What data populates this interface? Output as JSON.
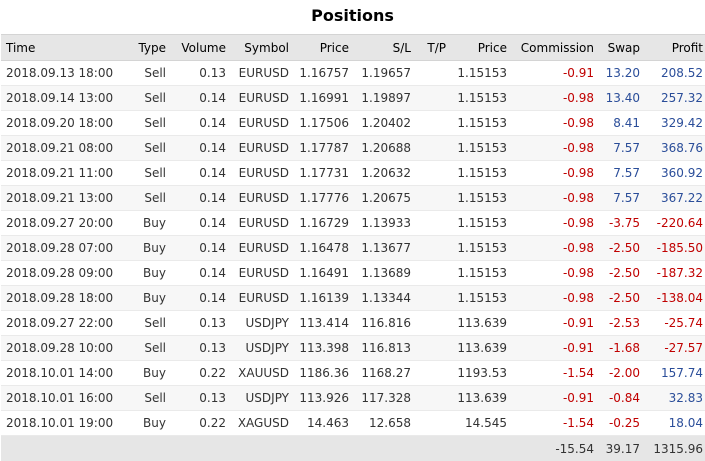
{
  "title": "Positions",
  "columns": {
    "time": "Time",
    "type": "Type",
    "volume": "Volume",
    "symbol": "Symbol",
    "price": "Price",
    "sl": "S/L",
    "tp": "T/P",
    "price2": "Price",
    "commission": "Commission",
    "swap": "Swap",
    "profit": "Profit"
  },
  "rows": [
    {
      "time": "2018.09.13 18:00",
      "type": "Sell",
      "volume": "0.13",
      "symbol": "EURUSD",
      "price": "1.16757",
      "sl": "1.19657",
      "tp": "",
      "price2": "1.15153",
      "commission": "-0.91",
      "swap": "13.20",
      "profit": "208.52"
    },
    {
      "time": "2018.09.14 13:00",
      "type": "Sell",
      "volume": "0.14",
      "symbol": "EURUSD",
      "price": "1.16991",
      "sl": "1.19897",
      "tp": "",
      "price2": "1.15153",
      "commission": "-0.98",
      "swap": "13.40",
      "profit": "257.32"
    },
    {
      "time": "2018.09.20 18:00",
      "type": "Sell",
      "volume": "0.14",
      "symbol": "EURUSD",
      "price": "1.17506",
      "sl": "1.20402",
      "tp": "",
      "price2": "1.15153",
      "commission": "-0.98",
      "swap": "8.41",
      "profit": "329.42"
    },
    {
      "time": "2018.09.21 08:00",
      "type": "Sell",
      "volume": "0.14",
      "symbol": "EURUSD",
      "price": "1.17787",
      "sl": "1.20688",
      "tp": "",
      "price2": "1.15153",
      "commission": "-0.98",
      "swap": "7.57",
      "profit": "368.76"
    },
    {
      "time": "2018.09.21 11:00",
      "type": "Sell",
      "volume": "0.14",
      "symbol": "EURUSD",
      "price": "1.17731",
      "sl": "1.20632",
      "tp": "",
      "price2": "1.15153",
      "commission": "-0.98",
      "swap": "7.57",
      "profit": "360.92"
    },
    {
      "time": "2018.09.21 13:00",
      "type": "Sell",
      "volume": "0.14",
      "symbol": "EURUSD",
      "price": "1.17776",
      "sl": "1.20675",
      "tp": "",
      "price2": "1.15153",
      "commission": "-0.98",
      "swap": "7.57",
      "profit": "367.22"
    },
    {
      "time": "2018.09.27 20:00",
      "type": "Buy",
      "volume": "0.14",
      "symbol": "EURUSD",
      "price": "1.16729",
      "sl": "1.13933",
      "tp": "",
      "price2": "1.15153",
      "commission": "-0.98",
      "swap": "-3.75",
      "profit": "-220.64"
    },
    {
      "time": "2018.09.28 07:00",
      "type": "Buy",
      "volume": "0.14",
      "symbol": "EURUSD",
      "price": "1.16478",
      "sl": "1.13677",
      "tp": "",
      "price2": "1.15153",
      "commission": "-0.98",
      "swap": "-2.50",
      "profit": "-185.50"
    },
    {
      "time": "2018.09.28 09:00",
      "type": "Buy",
      "volume": "0.14",
      "symbol": "EURUSD",
      "price": "1.16491",
      "sl": "1.13689",
      "tp": "",
      "price2": "1.15153",
      "commission": "-0.98",
      "swap": "-2.50",
      "profit": "-187.32"
    },
    {
      "time": "2018.09.28 18:00",
      "type": "Buy",
      "volume": "0.14",
      "symbol": "EURUSD",
      "price": "1.16139",
      "sl": "1.13344",
      "tp": "",
      "price2": "1.15153",
      "commission": "-0.98",
      "swap": "-2.50",
      "profit": "-138.04"
    },
    {
      "time": "2018.09.27 22:00",
      "type": "Sell",
      "volume": "0.13",
      "symbol": "USDJPY",
      "price": "113.414",
      "sl": "116.816",
      "tp": "",
      "price2": "113.639",
      "commission": "-0.91",
      "swap": "-2.53",
      "profit": "-25.74"
    },
    {
      "time": "2018.09.28 10:00",
      "type": "Sell",
      "volume": "0.13",
      "symbol": "USDJPY",
      "price": "113.398",
      "sl": "116.813",
      "tp": "",
      "price2": "113.639",
      "commission": "-0.91",
      "swap": "-1.68",
      "profit": "-27.57"
    },
    {
      "time": "2018.10.01 14:00",
      "type": "Buy",
      "volume": "0.22",
      "symbol": "XAUUSD",
      "price": "1186.36",
      "sl": "1168.27",
      "tp": "",
      "price2": "1193.53",
      "commission": "-1.54",
      "swap": "-2.00",
      "profit": "157.74"
    },
    {
      "time": "2018.10.01 16:00",
      "type": "Sell",
      "volume": "0.13",
      "symbol": "USDJPY",
      "price": "113.926",
      "sl": "117.328",
      "tp": "",
      "price2": "113.639",
      "commission": "-0.91",
      "swap": "-0.84",
      "profit": "32.83"
    },
    {
      "time": "2018.10.01 19:00",
      "type": "Buy",
      "volume": "0.22",
      "symbol": "XAGUSD",
      "price": "14.463",
      "sl": "12.658",
      "tp": "",
      "price2": "14.545",
      "commission": "-1.54",
      "swap": "-0.25",
      "profit": "18.04"
    }
  ],
  "totals": {
    "commission": "-15.54",
    "swap": "39.17",
    "profit": "1315.96"
  },
  "colors": {
    "negative": "#c00000",
    "positive": "#2a4d99",
    "header_bg": "#e6e6e6"
  }
}
